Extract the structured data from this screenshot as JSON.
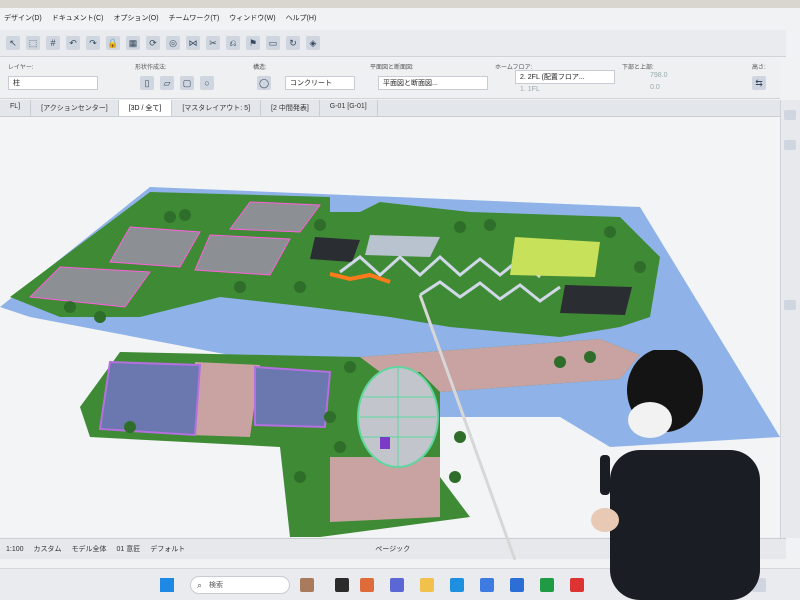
{
  "menu": [
    "デザイン(D)",
    "ドキュメント(C)",
    "オプション(O)",
    "チームワーク(T)",
    "ウィンドウ(W)",
    "ヘルプ(H)"
  ],
  "infobox": {
    "layer_label": "レイヤー:",
    "layer_value": "柱",
    "geometry_label": "形状作成法:",
    "structure_label": "構造:",
    "structure_value": "コンクリート",
    "floorplan_label": "平面図と断面図:",
    "floorplan_value": "平面図と断面図...",
    "home_label": "ホームフロア:",
    "home_value": "2. 2FL (配置フロア...",
    "home_sub": "1. 1FL",
    "top_label": "下部と上部:",
    "top_value1": "798.0",
    "top_value2": "0.0",
    "anchor_label": "高さ:"
  },
  "tabs": [
    {
      "label": "FL]",
      "active": false
    },
    {
      "label": "[アクションセンター]",
      "active": false
    },
    {
      "label": "[3D / 全て]",
      "active": true
    },
    {
      "label": "[マスタレイアウト: 5]",
      "active": false
    },
    {
      "label": "[2 中間発表]",
      "active": false
    },
    {
      "label": "G-01 [G-01]",
      "active": false
    }
  ],
  "status": {
    "scale": "1:100",
    "fit": "カスタム",
    "model": "モデル全体",
    "view": "01 意匠",
    "default": "デフォルト",
    "page": "ページック"
  },
  "taskbar": {
    "search_placeholder": "検索"
  },
  "colors": {
    "ground_green": "#3f8a35",
    "tree_green": "#2f6e2a",
    "roof_gray": "#8c8f94",
    "pond_blue": "#6b78b0",
    "path_pink": "#c9a2a2",
    "base_blue": "#8fb3e8",
    "accent_lime": "#c7e25a"
  }
}
